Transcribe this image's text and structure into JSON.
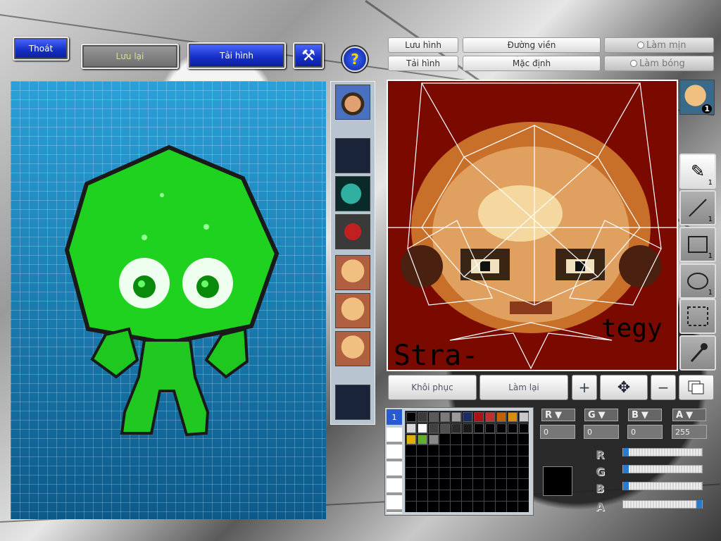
{
  "top_buttons": {
    "exit": "Thoát",
    "save": "Lưu lại",
    "reload": "Tải hình",
    "help_icon": "help-icon",
    "hammer_icon": "hammer-icon"
  },
  "editor_tabs": {
    "save_image": "Lưu hình",
    "load_image": "Tải hình",
    "outline": "Đường viền",
    "default": "Mặc định",
    "smooth": "Làm mịn",
    "shiny": "Làm bóng"
  },
  "face_slot": {
    "count": "1"
  },
  "tools": [
    {
      "name": "pen-tool",
      "count": "1"
    },
    {
      "name": "line-tool",
      "count": "1"
    },
    {
      "name": "rect-tool",
      "count": "1"
    },
    {
      "name": "ellipse-tool",
      "count": "1"
    },
    {
      "name": "select-tool",
      "count": ""
    },
    {
      "name": "eyedropper-tool",
      "count": ""
    }
  ],
  "canvas_text": {
    "left": "Stra-",
    "right": "tegy"
  },
  "actions": {
    "restore": "Khôi phục",
    "redo": "Làm lại"
  },
  "palette": {
    "page_tab": "1",
    "colors_row1": [
      "#000000",
      "#3a3a3a",
      "#5a5a5a",
      "#7a7a7a",
      "#9a9a9a",
      "#1a2a6a",
      "#b01010",
      "#c03030",
      "#c06000",
      "#d09010",
      "#c8c8c8"
    ],
    "colors_row2": [
      "#d8d8d8",
      "#ffffff",
      "#404040",
      "#505050",
      "#2a2a2a",
      "#1a1a1a",
      "#000000",
      "#000000",
      "#000000",
      "#000000",
      "#000000"
    ],
    "colors_row3": [
      "#e0b000",
      "#60b030",
      "#888888"
    ]
  },
  "channels": {
    "r_label": "R",
    "g_label": "G",
    "b_label": "B",
    "a_label": "A",
    "r_value": "0",
    "g_value": "0",
    "b_value": "0",
    "a_value": "255",
    "r_level": 0,
    "g_level": 0,
    "b_level": 0,
    "a_level": 1
  },
  "current_color": "#000000"
}
